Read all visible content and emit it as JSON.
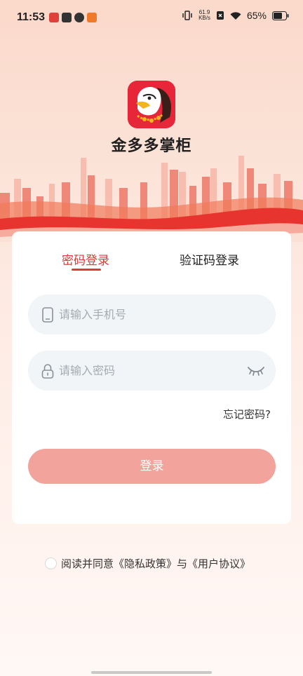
{
  "status_bar": {
    "time": "11:53",
    "net_speed_value": "61.9",
    "net_speed_unit": "KB/s",
    "battery": "65%",
    "notification_colors": [
      "#e0403a",
      "#333333",
      "#333333",
      "#f07a2a"
    ]
  },
  "app": {
    "name": "金多多掌柜",
    "brand_color": "#e8263a"
  },
  "tabs": {
    "password_login": "密码登录",
    "code_login": "验证码登录",
    "active": "password_login",
    "active_color": "#d93a3a"
  },
  "form": {
    "phone_placeholder": "请输入手机号",
    "phone_icon": "phone-icon",
    "password_placeholder": "请输入密码",
    "password_icon": "lock-icon",
    "password_toggle_icon": "eye-closed-icon",
    "forgot_password": "忘记密码?",
    "login_button": "登录",
    "login_button_color": "#f2a39c"
  },
  "agreement": {
    "prefix": "阅读并同意",
    "privacy_policy": "《隐私政策》",
    "connector": "与",
    "user_agreement": "《用户协议》"
  }
}
